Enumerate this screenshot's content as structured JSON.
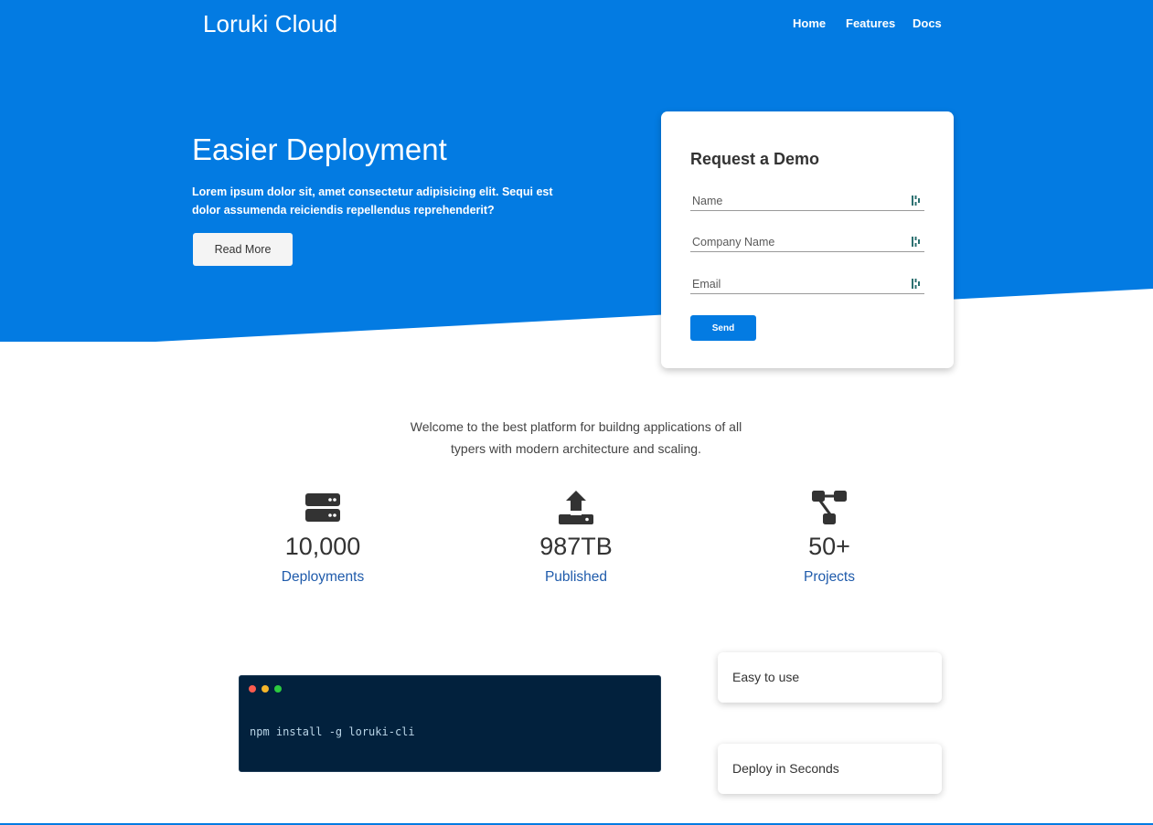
{
  "brand": {
    "name": "Loruki Cloud",
    "color": "#037be2"
  },
  "nav": {
    "items": [
      {
        "label": "Home"
      },
      {
        "label": "Features"
      },
      {
        "label": "Docs"
      }
    ]
  },
  "hero": {
    "title": "Easier Deployment",
    "text": "Lorem ipsum dolor sit, amet consectetur adipisicing elit. Sequi est dolor assumenda reiciendis repellendus reprehenderit?",
    "button_label": "Read More"
  },
  "demo_form": {
    "title": "Request a Demo",
    "fields": [
      {
        "placeholder": "Name",
        "value": ""
      },
      {
        "placeholder": "Company Name",
        "value": ""
      },
      {
        "placeholder": "Email",
        "value": ""
      }
    ],
    "submit_label": "Send"
  },
  "welcome": {
    "text": "Welcome to the best platform for buildng applications of all typers with modern architecture and scaling."
  },
  "stats": [
    {
      "icon": "server-icon",
      "value": "10,000",
      "label": "Deployments"
    },
    {
      "icon": "upload-icon",
      "value": "987TB",
      "label": "Published"
    },
    {
      "icon": "project-diagram-icon",
      "value": "50+",
      "label": "Projects"
    }
  ],
  "terminal": {
    "command": "npm install -g loruki-cli"
  },
  "features": [
    {
      "label": "Easy to use"
    },
    {
      "label": "Deploy in Seconds"
    }
  ]
}
